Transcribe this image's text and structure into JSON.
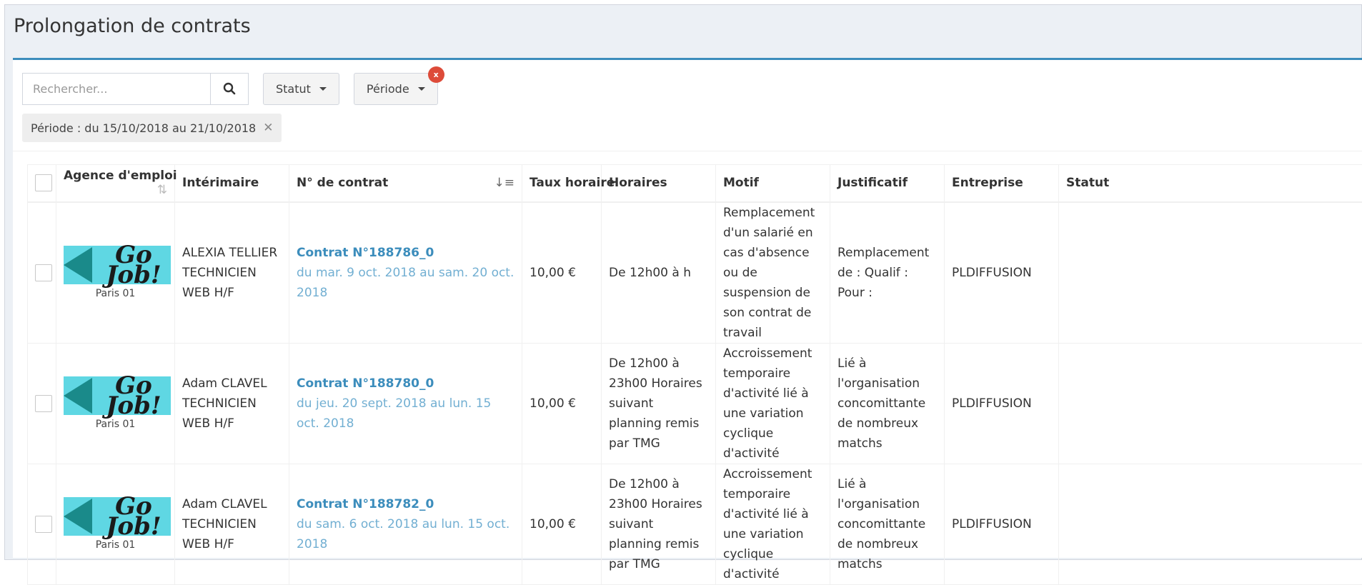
{
  "page": {
    "title": "Prolongation de contrats"
  },
  "toolbar": {
    "search_placeholder": "Rechercher...",
    "status_label": "Statut",
    "period_label": "Période",
    "period_badge": "x"
  },
  "filter": {
    "label": "Période : du 15/10/2018 au 21/10/2018"
  },
  "columns": [
    "Agence d'emploi",
    "Intérimaire",
    "N° de contrat",
    "Taux horaire",
    "Horaires",
    "Motif",
    "Justificatif",
    "Entreprise",
    "Statut"
  ],
  "rows": [
    {
      "agency_logo": "Go Job!",
      "agency_city": "Paris 01",
      "worker_name": "ALEXIA TELLIER",
      "worker_role": "TECHNICIEN WEB H/F",
      "contract_number": "Contrat N°188786_0",
      "contract_dates": "du mar. 9 oct. 2018 au sam. 20 oct. 2018",
      "rate": "10,00 €",
      "hours": "De 12h00 à h",
      "reason": "Remplacement d'un salarié en cas d'absence ou de suspension de son contrat de travail",
      "justification": "Remplacement de : Qualif : Pour :",
      "company": "PLDIFFUSION",
      "status": ""
    },
    {
      "agency_logo": "Go Job!",
      "agency_city": "Paris 01",
      "worker_name": "Adam CLAVEL",
      "worker_role": "TECHNICIEN WEB H/F",
      "contract_number": "Contrat N°188780_0",
      "contract_dates": "du jeu. 20 sept. 2018 au lun. 15 oct. 2018",
      "rate": "10,00 €",
      "hours": "De 12h00 à 23h00 Horaires suivant planning remis par TMG",
      "reason": "Accroissement temporaire d'activité lié à une variation cyclique d'activité",
      "justification": "Lié à l'organisation concomittante de nombreux matchs",
      "company": "PLDIFFUSION",
      "status": ""
    },
    {
      "agency_logo": "Go Job!",
      "agency_city": "Paris 01",
      "worker_name": "Adam CLAVEL",
      "worker_role": "TECHNICIEN WEB H/F",
      "contract_number": "Contrat N°188782_0",
      "contract_dates": "du sam. 6 oct. 2018 au lun. 15 oct. 2018",
      "rate": "10,00 €",
      "hours": "De 12h00 à 23h00 Horaires suivant planning remis par TMG",
      "reason": "Accroissement temporaire d'activité lié à une variation cyclique d'activité",
      "justification": "Lié à l'organisation concomittante de nombreux matchs",
      "company": "PLDIFFUSION",
      "status": ""
    }
  ]
}
